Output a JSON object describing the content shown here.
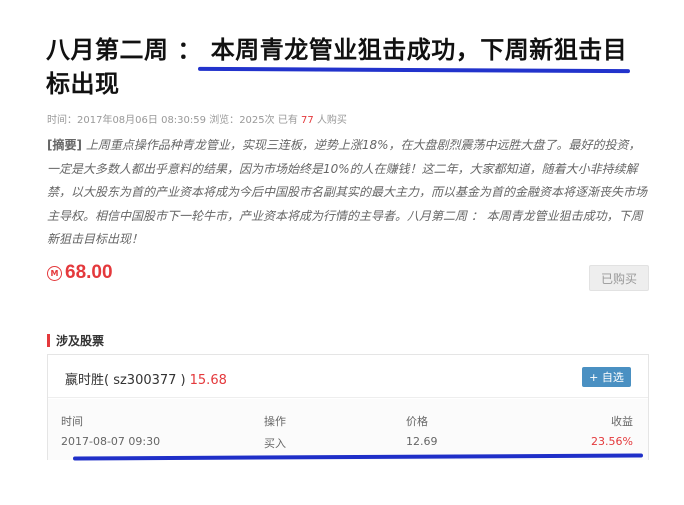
{
  "article": {
    "title": "八月第二周 ： 本周青龙管业狙击成功，下周新狙击目标出现",
    "meta": {
      "time_label": "时间：",
      "time_value": "2017年08月06日 08:30:59",
      "views_label": "浏览：",
      "views_value": "2025次",
      "bought_prefix": "已有",
      "bought_count": "77",
      "bought_suffix": "人购买"
    },
    "summary_tag": "[摘要]",
    "summary_text": "上周重点操作品种青龙管业，实现三连板，逆势上涨18%，在大盘剧烈震荡中远胜大盘了。最好的投资，一定是大多数人都出乎意料的结果，因为市场始终是10%的人在赚钱！这二年，大家都知道，随着大小非持续解禁，以大股东为首的产业资本将成为今后中国股市名副其实的最大主力，而以基金为首的金融资本将逐渐丧失市场主导权。相信中国股市下一轮牛市，产业资本将成为行情的主导者。八月第二周 ： 本周青龙管业狙击成功，下周新狙击目标出现！"
  },
  "price": {
    "icon": "coin-icon",
    "icon_glyph": "M",
    "value": "68.00",
    "button_label": "已购买"
  },
  "stocks": {
    "section_title": "涉及股票",
    "name": "嬴时胜( sz300377 )",
    "price": "15.68",
    "add_label": "+ 自选",
    "headers": [
      "时间",
      "操作",
      "价格",
      "收益"
    ],
    "row": [
      "2017-08-07 09:30",
      "买入",
      "12.69",
      "23.56%"
    ]
  },
  "colors": {
    "accent_red": "#e4393c",
    "button_blue": "#4a90c2",
    "annotation_blue": "#2233cc"
  }
}
